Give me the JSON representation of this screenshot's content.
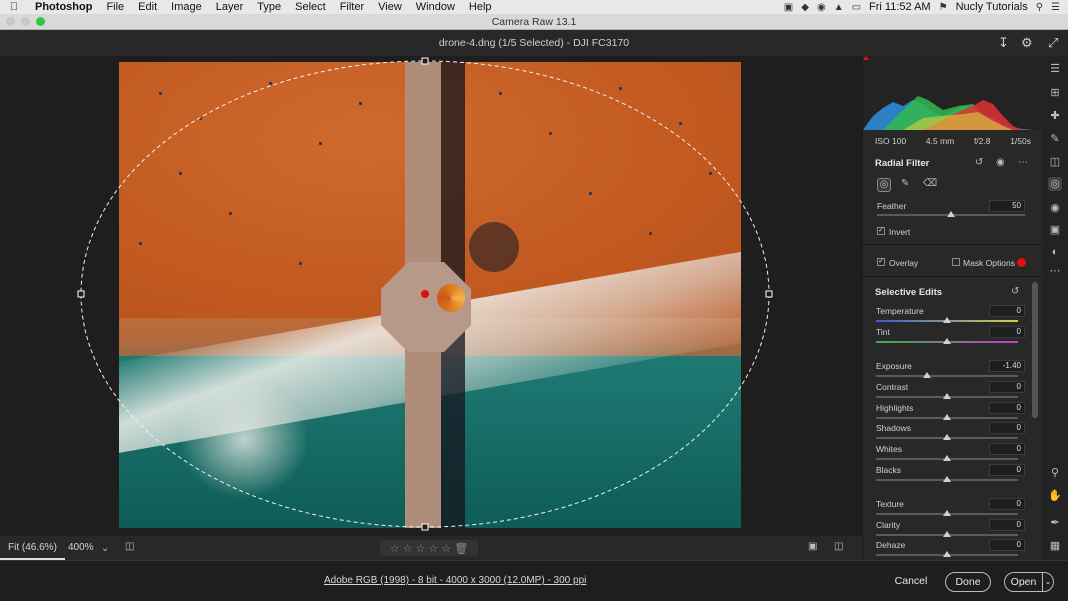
{
  "menubar": {
    "apple_icon": "apple-logo-icon",
    "app_name": "Photoshop",
    "menus": [
      "File",
      "Edit",
      "Image",
      "Layer",
      "Type",
      "Select",
      "Filter",
      "View",
      "Window",
      "Help"
    ],
    "clock": "Fri 11:52 AM",
    "user": "Nucly Tutorials"
  },
  "window": {
    "title": "Camera Raw 13.1"
  },
  "filebar": {
    "filename": "drone-4.dng (1/5 Selected)  -  DJI FC3170"
  },
  "histogram": {
    "iso": "ISO 100",
    "focal": "4.5 mm",
    "aperture": "f/2.8",
    "shutter": "1/50s"
  },
  "radial_filter": {
    "title": "Radial Filter",
    "feather_label": "Feather",
    "feather_value": "50",
    "feather_fraction": 0.5,
    "invert_label": "Invert",
    "invert_checked": true,
    "overlay_label": "Overlay",
    "overlay_checked": true,
    "mask_options_label": "Mask Options",
    "mask_color": "#e01010"
  },
  "selective_edits": {
    "title": "Selective Edits",
    "sliders": [
      {
        "label": "Temperature",
        "value": "0",
        "fraction": 0.5
      },
      {
        "label": "Tint",
        "value": "0",
        "fraction": 0.5
      },
      {
        "label": "Exposure",
        "value": "-1.40",
        "fraction": 0.36
      },
      {
        "label": "Contrast",
        "value": "0",
        "fraction": 0.5
      },
      {
        "label": "Highlights",
        "value": "0",
        "fraction": 0.5
      },
      {
        "label": "Shadows",
        "value": "0",
        "fraction": 0.5
      },
      {
        "label": "Whites",
        "value": "0",
        "fraction": 0.5
      },
      {
        "label": "Blacks",
        "value": "0",
        "fraction": 0.5
      },
      {
        "label": "Texture",
        "value": "0",
        "fraction": 0.5
      },
      {
        "label": "Clarity",
        "value": "0",
        "fraction": 0.5
      },
      {
        "label": "Dehaze",
        "value": "0",
        "fraction": 0.5
      }
    ]
  },
  "bottom_bar": {
    "fit_label": "Fit (46.6%)",
    "zoom_label": "400%"
  },
  "footer": {
    "info": "Adobe RGB (1998) - 8 bit - 4000 x 3000 (12.0MP) - 300 ppi",
    "cancel": "Cancel",
    "done": "Done",
    "open": "Open"
  },
  "colors": {
    "accent": "#e01010",
    "panel_bg": "#282828",
    "canvas_bg": "#1e1e1e"
  }
}
